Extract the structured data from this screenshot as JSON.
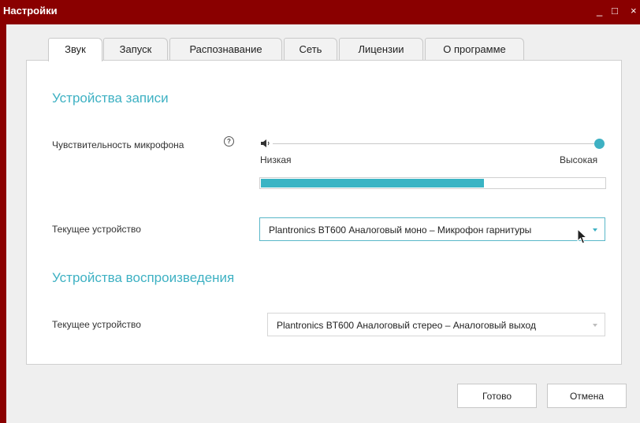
{
  "window": {
    "title": "Настройки",
    "minimize_label": "_",
    "maximize_label": "□",
    "close_label": "×"
  },
  "tabs": [
    {
      "label": "Звук",
      "active": true
    },
    {
      "label": "Запуск",
      "active": false
    },
    {
      "label": "Распознавание",
      "active": false
    },
    {
      "label": "Сеть",
      "active": false
    },
    {
      "label": "Лицензии",
      "active": false
    },
    {
      "label": "О программе",
      "active": false
    }
  ],
  "recording": {
    "section_title": "Устройства записи",
    "sensitivity_label": "Чувствительность микрофона",
    "help_icon": "question-circle-icon",
    "help_glyph": "?",
    "speaker_icon": "speaker-icon",
    "slider_min_label": "Низкая",
    "slider_max_label": "Высокая",
    "slider_value": 1.0,
    "level_value": 0.65,
    "device_label": "Текущее устройство",
    "device_value": "Plantronics BT600 Аналоговый моно – Микрофон гарнитуры"
  },
  "playback": {
    "section_title": "Устройства воспроизведения",
    "device_label": "Текущее устройство",
    "device_value": "Plantronics BT600 Аналоговый стерео – Аналоговый выход"
  },
  "footer": {
    "ok_label": "Готово",
    "cancel_label": "Отмена"
  },
  "colors": {
    "titlebar": "#8a0000",
    "accent": "#3eb1c3"
  }
}
